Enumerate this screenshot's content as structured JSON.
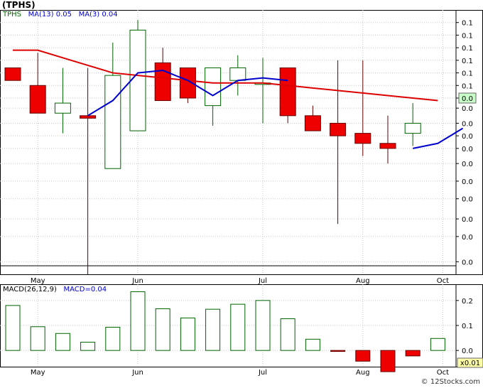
{
  "title": "(TPHS)",
  "credit": "© 12Stocks.com",
  "colors": {
    "up_fill": "#ffffff",
    "up_stroke": "#006400",
    "down_fill": "#ee0000",
    "down_stroke": "#660000",
    "ma13": "#dd0000",
    "ma3": "#0000cc",
    "grid": "#c8c8c8",
    "badge_price": "#c8ffc8",
    "badge_macd": "#ffffaa"
  },
  "chart_data": [
    {
      "type": "candlestick",
      "legend": {
        "symbol": "TPHS",
        "ma13_label": "MA(13)",
        "ma13_value": "0.05",
        "ma3_label": "MA(3)",
        "ma3_value": "0.04"
      },
      "x_labels": [
        {
          "label": "May",
          "index": 1
        },
        {
          "label": "Jun",
          "index": 5
        },
        {
          "label": "Jul",
          "index": 10
        },
        {
          "label": "Aug",
          "index": 14
        },
        {
          "label": "Oct",
          "index": 17.2
        }
      ],
      "y_tick_labels": [
        "0.1",
        "0.1",
        "0.1",
        "0.1",
        "0.1",
        "0.1",
        "0.0",
        "0.0",
        "0.0",
        "0.0",
        "0.0",
        "0.0",
        "0.0",
        "0.0",
        "0.0",
        "0.0",
        "0.0"
      ],
      "y_tick_values": [
        0.1,
        0.095,
        0.09,
        0.085,
        0.08,
        0.075,
        0.07,
        0.066,
        0.06,
        0.055,
        0.05,
        0.044,
        0.037,
        0.03,
        0.022,
        0.015,
        0.005
      ],
      "ylim": [
        0.0,
        0.105
      ],
      "last_price_label": "0.0",
      "candles": [
        {
          "open": 0.082,
          "high": 0.082,
          "low": 0.077,
          "close": 0.077
        },
        {
          "open": 0.075,
          "high": 0.088,
          "low": 0.064,
          "close": 0.064
        },
        {
          "open": 0.064,
          "high": 0.082,
          "low": 0.056,
          "close": 0.068
        },
        {
          "open": 0.063,
          "high": 0.082,
          "low": 0.0,
          "close": 0.062
        },
        {
          "open": 0.042,
          "high": 0.092,
          "low": 0.042,
          "close": 0.079
        },
        {
          "open": 0.057,
          "high": 0.101,
          "low": 0.057,
          "close": 0.097
        },
        {
          "open": 0.084,
          "high": 0.09,
          "low": 0.069,
          "close": 0.069
        },
        {
          "open": 0.082,
          "high": 0.082,
          "low": 0.068,
          "close": 0.07
        },
        {
          "open": 0.067,
          "high": 0.082,
          "low": 0.059,
          "close": 0.082
        },
        {
          "open": 0.077,
          "high": 0.087,
          "low": 0.071,
          "close": 0.082
        },
        {
          "open": 0.076,
          "high": 0.086,
          "low": 0.06,
          "close": 0.076
        },
        {
          "open": 0.082,
          "high": 0.082,
          "low": 0.06,
          "close": 0.063
        },
        {
          "open": 0.063,
          "high": 0.067,
          "low": 0.057,
          "close": 0.057
        },
        {
          "open": 0.06,
          "high": 0.085,
          "low": 0.02,
          "close": 0.055
        },
        {
          "open": 0.056,
          "high": 0.085,
          "low": 0.047,
          "close": 0.052
        },
        {
          "open": 0.052,
          "high": 0.063,
          "low": 0.044,
          "close": 0.05
        },
        {
          "open": 0.056,
          "high": 0.068,
          "low": 0.051,
          "close": 0.06
        }
      ],
      "ma13": [
        0.089,
        0.089,
        0.086,
        0.083,
        0.08,
        0.079,
        0.078,
        0.077,
        0.076,
        0.076,
        0.076,
        0.075,
        0.074,
        0.073,
        0.072,
        0.071,
        0.07,
        0.069
      ],
      "ma3": [
        null,
        null,
        null,
        0.063,
        0.069,
        0.08,
        0.081,
        0.077,
        0.071,
        0.077,
        0.078,
        0.077,
        null,
        null,
        null,
        null,
        0.05,
        0.052,
        0.058
      ]
    },
    {
      "type": "bar",
      "legend": {
        "label": "MACD(26,12,9)",
        "value_label": "MACD=0.04"
      },
      "y_tick_labels": [
        "0.2",
        "0.1",
        "0.0"
      ],
      "y_tick_values": [
        0.2,
        0.1,
        0.0
      ],
      "ylim": [
        -0.065,
        0.265
      ],
      "last_value_label": "x0.01",
      "values": [
        0.18,
        0.095,
        0.068,
        0.033,
        0.093,
        0.235,
        0.167,
        0.13,
        0.165,
        0.185,
        0.2,
        0.127,
        0.045,
        -0.004,
        -0.043,
        -0.085,
        -0.022,
        0.048
      ]
    }
  ]
}
